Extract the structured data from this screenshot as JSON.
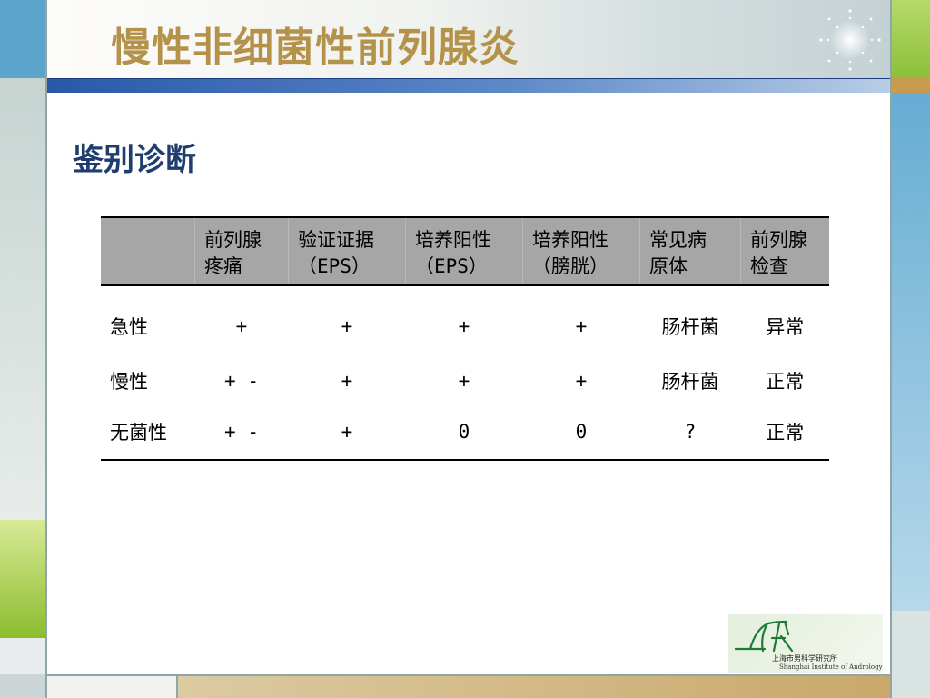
{
  "slide": {
    "title": "慢性非细菌性前列腺炎",
    "section_title": "鉴别诊断"
  },
  "table": {
    "headers": [
      {
        "line1": "",
        "line2": ""
      },
      {
        "line1": "前列腺",
        "line2": "疼痛"
      },
      {
        "line1": "验证证据",
        "line2": "（EPS）"
      },
      {
        "line1": "培养阳性",
        "line2": "（EPS）"
      },
      {
        "line1": "培养阳性",
        "line2": "（膀胱）"
      },
      {
        "line1": "常见病",
        "line2": "原体"
      },
      {
        "line1": "前列腺",
        "line2": "检查"
      }
    ],
    "rows": [
      [
        "急性",
        "+",
        "+",
        "+",
        "+",
        "肠杆菌",
        "异常"
      ],
      [
        "慢性",
        "+ -",
        "+",
        "+",
        "+",
        "肠杆菌",
        "正常"
      ],
      [
        "无菌性",
        "+ -",
        "+",
        "0",
        "0",
        "?",
        "正常"
      ]
    ]
  },
  "logo": {
    "text_cn": "上海市男科学研究所",
    "text_en": "Shanghai Institute of Andrology"
  },
  "colors": {
    "title": "#b5924a",
    "section_title": "#1f3d6e",
    "header_bg": "#a6a6a6"
  }
}
